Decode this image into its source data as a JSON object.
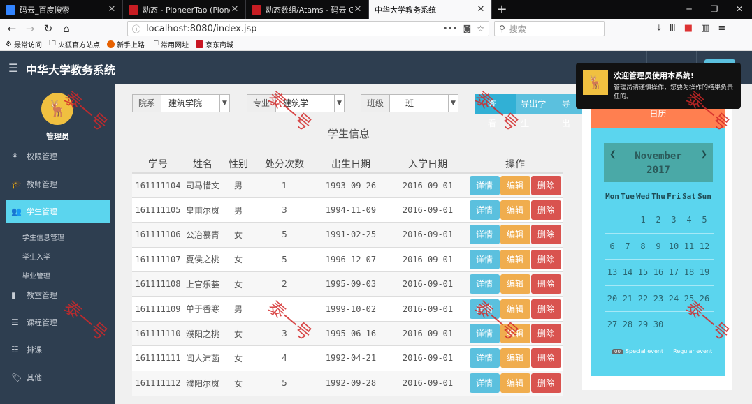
{
  "browser": {
    "tabs": [
      {
        "title": "码云_百度搜索",
        "color": "#3385ff"
      },
      {
        "title": "动态 - PioneerTao (PioneerTa",
        "color": "#c71d23"
      },
      {
        "title": "动态数组/Atams - 码云 Gitee",
        "color": "#c71d23"
      },
      {
        "title": "中华大学教务系统",
        "color": "#ffffff"
      }
    ],
    "url": "localhost:8080/index.jsp",
    "search_placeholder": "搜索",
    "bookmarks": [
      "最常访问",
      "火狐官方站点",
      "新手上路",
      "常用网址",
      "京东商城"
    ]
  },
  "app": {
    "title": "中华大学教务系统",
    "admin_name": "管理员",
    "avatar_icon": "deer-icon"
  },
  "sidebar": {
    "items": [
      {
        "label": "权限管理",
        "icon": "sitemap-icon"
      },
      {
        "label": "教师管理",
        "icon": "graduation-cap-icon"
      },
      {
        "label": "学生管理",
        "icon": "users-icon"
      },
      {
        "label": "教室管理",
        "icon": "book-icon"
      },
      {
        "label": "课程管理",
        "icon": "list-icon"
      },
      {
        "label": "排课",
        "icon": "list-ol-icon"
      },
      {
        "label": "其他",
        "icon": "tags-icon"
      }
    ],
    "subitems": [
      "学生信息管理",
      "学生入学",
      "毕业管理"
    ]
  },
  "filters": {
    "college": {
      "label": "院系",
      "value": "建筑学院"
    },
    "major": {
      "label": "专业",
      "value": "建筑学"
    },
    "clazz": {
      "label": "班级",
      "value": "一班"
    }
  },
  "buttons": {
    "search": "查看",
    "export": "导出学生",
    "export2": "导出"
  },
  "section_title": "学生信息",
  "table": {
    "headers": [
      "学号",
      "姓名",
      "性别",
      "处分次数",
      "出生日期",
      "入学日期",
      "操作"
    ],
    "rows": [
      [
        "161111104",
        "司马惜文",
        "男",
        "1",
        "1993-09-26",
        "2016-09-01"
      ],
      [
        "161111105",
        "皇甫尔岚",
        "男",
        "3",
        "1994-11-09",
        "2016-09-01"
      ],
      [
        "161111106",
        "公冶慕青",
        "女",
        "5",
        "1991-02-25",
        "2016-09-01"
      ],
      [
        "161111107",
        "夏侯之桃",
        "女",
        "5",
        "1996-12-07",
        "2016-09-01"
      ],
      [
        "161111108",
        "上官乐荟",
        "女",
        "2",
        "1995-09-03",
        "2016-09-01"
      ],
      [
        "161111109",
        "单于香寒",
        "男",
        "",
        "1999-10-02",
        "2016-09-01"
      ],
      [
        "161111110",
        "濮阳之桃",
        "女",
        "3",
        "1995-06-16",
        "2016-09-01"
      ],
      [
        "161111111",
        "闻人沛菡",
        "女",
        "4",
        "1992-04-21",
        "2016-09-01"
      ],
      [
        "161111112",
        "濮阳尔岚",
        "女",
        "5",
        "1992-09-28",
        "2016-09-01"
      ]
    ],
    "actions": {
      "detail": "详情",
      "edit": "编辑",
      "delete": "删除"
    }
  },
  "calendar": {
    "header": "日历",
    "month": "November",
    "year": "2017",
    "dow": [
      "Mon",
      "Tue",
      "Wed",
      "Thu",
      "Fri",
      "Sat",
      "Sun"
    ],
    "weeks": [
      [
        "",
        "",
        "1",
        "2",
        "3",
        "4",
        "5"
      ],
      [
        "6",
        "7",
        "8",
        "9",
        "10",
        "11",
        "12"
      ],
      [
        "13",
        "14",
        "15",
        "16",
        "17",
        "18",
        "19"
      ],
      [
        "20",
        "21",
        "22",
        "23",
        "24",
        "25",
        "26"
      ],
      [
        "27",
        "28",
        "29",
        "30",
        "",
        "",
        ""
      ]
    ],
    "legend_badge": "00",
    "legend_special": "Special event",
    "legend_regular": "Regular event"
  },
  "toast": {
    "title": "欢迎管理员使用本系统!",
    "message": "管理员请谨慎操作，您要为操作的结果负责任的。"
  },
  "watermark": "泰一号"
}
